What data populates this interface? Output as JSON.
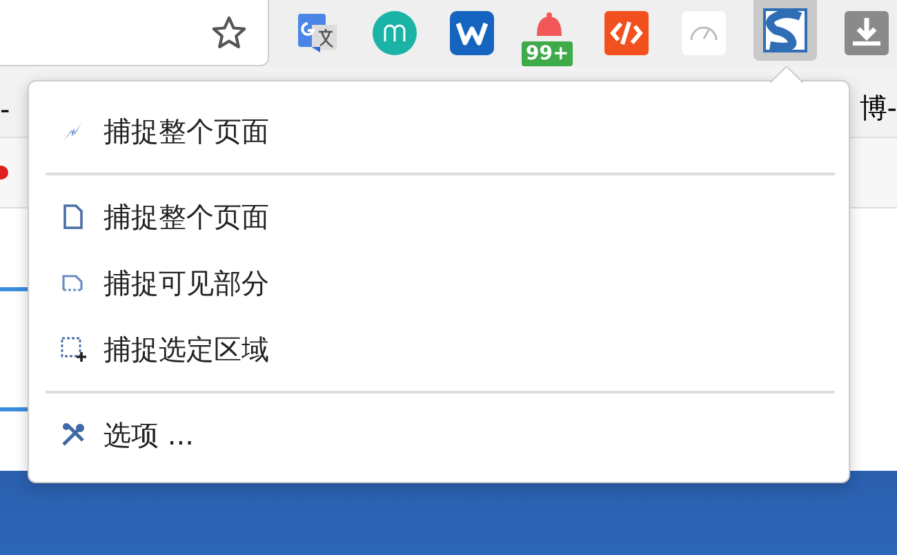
{
  "toolbar": {
    "extensions": [
      {
        "kind": "translate",
        "selected": false
      },
      {
        "kind": "m",
        "selected": false
      },
      {
        "kind": "w",
        "selected": false
      },
      {
        "kind": "bell",
        "selected": false,
        "badge": "99+"
      },
      {
        "kind": "code",
        "selected": false
      },
      {
        "kind": "gauge",
        "selected": false
      },
      {
        "kind": "s",
        "selected": true
      },
      {
        "kind": "download",
        "selected": false
      }
    ]
  },
  "page": {
    "left_text": "-",
    "right_text": "博-"
  },
  "menu": {
    "groups": [
      [
        {
          "kind": "spark",
          "label": "捕捉整个页面"
        }
      ],
      [
        {
          "kind": "page",
          "label": "捕捉整个页面"
        },
        {
          "kind": "visible",
          "label": "捕捉可见部分"
        },
        {
          "kind": "region",
          "label": "捕捉选定区域"
        }
      ],
      [
        {
          "kind": "tools",
          "label": "选项 ..."
        }
      ]
    ]
  }
}
